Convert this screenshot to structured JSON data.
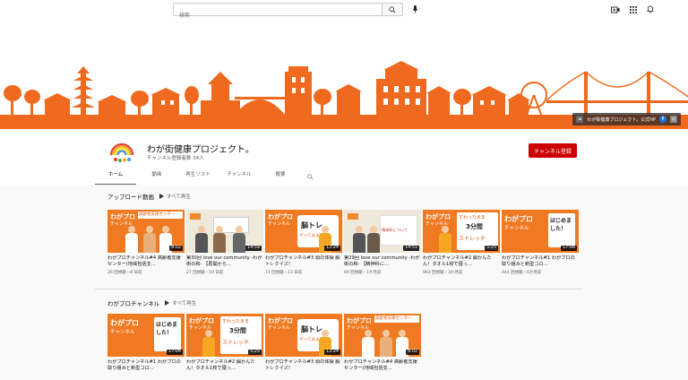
{
  "search": {
    "placeholder": "検索"
  },
  "colors": {
    "brand_orange": "#ef6a1e",
    "subscribe_red": "#cc0000"
  },
  "banner": {
    "links_text": "わが街健康プロジェクト。公式HP"
  },
  "channel": {
    "name": "わが街健康プロジェクト。",
    "subscribers": "チャンネル登録者数 34人",
    "subscribe_label": "チャンネル登録"
  },
  "tabs": [
    {
      "label": "ホーム",
      "active": true
    },
    {
      "label": "動画"
    },
    {
      "label": "再生リスト"
    },
    {
      "label": "チャンネル"
    },
    {
      "label": "概要"
    }
  ],
  "uploads": {
    "title": "アップロード動画",
    "play_all": "すべて再生",
    "videos": [
      {
        "duration": "8:02",
        "title": "わがプロチャンネル#4 高齢者支援センター(地域包括支...",
        "meta": "26 回視聴・8 日前",
        "thumb": "a"
      },
      {
        "duration": "14:59",
        "title": "第30回 love our community -わが街の和- 【再開から...",
        "meta": "27 回視聴・10 日前",
        "thumb": "b"
      },
      {
        "duration": "12:24",
        "title": "わがプロチャンネル#3 頭の体操 脳トレクイズ！",
        "meta": "71 回視聴・13 日前",
        "thumb": "c"
      },
      {
        "duration": "14:51",
        "title": "第29回 love our community -わが街の和- 【精神科に...",
        "meta": "69 回視聴・1か月前",
        "thumb": "d"
      },
      {
        "duration": "5:25",
        "title": "わがプロチャンネル#2 脳かんたん！タオル1枚で寝っ...",
        "meta": "963 回視聴・3か月前",
        "thumb": "e"
      },
      {
        "duration": "17:06",
        "title": "わがプロチャンネル#1 わがプロの取り組みと新型コロ...",
        "meta": "444 回視聴・6か月前",
        "thumb": "f"
      }
    ]
  },
  "channel_section": {
    "title": "わがプロチャンネル",
    "play_all": "すべて再生",
    "videos": [
      {
        "duration": "17:06",
        "title": "わがプロチャンネル#1 わがプロの取り組みと新型コロ...",
        "thumb": "f"
      },
      {
        "duration": "5:25",
        "title": "わがプロチャンネル#2 脳かんたん！タオル1枚で寝っ...",
        "thumb": "e"
      },
      {
        "duration": "12:24",
        "title": "わがプロチャンネル#3 頭の体操 脳トレクイズ！",
        "thumb": "c"
      },
      {
        "duration": "8:02",
        "title": "わがプロチャンネル#4 高齢者支援センター(地域包括支...",
        "thumb": "a"
      }
    ]
  },
  "thumb_text": {
    "wagapuro": "わがプロ",
    "channel": "チャンネル",
    "center": "高齢者支援センター",
    "hajime": "はじめました！",
    "stretch_1": "すわったまま",
    "stretch_2": "3分間",
    "stretch_3": "ストレッチ",
    "noutore_1": "脳トレ",
    "noutore_2": "やってみよう！",
    "seishin": "精神科について"
  }
}
